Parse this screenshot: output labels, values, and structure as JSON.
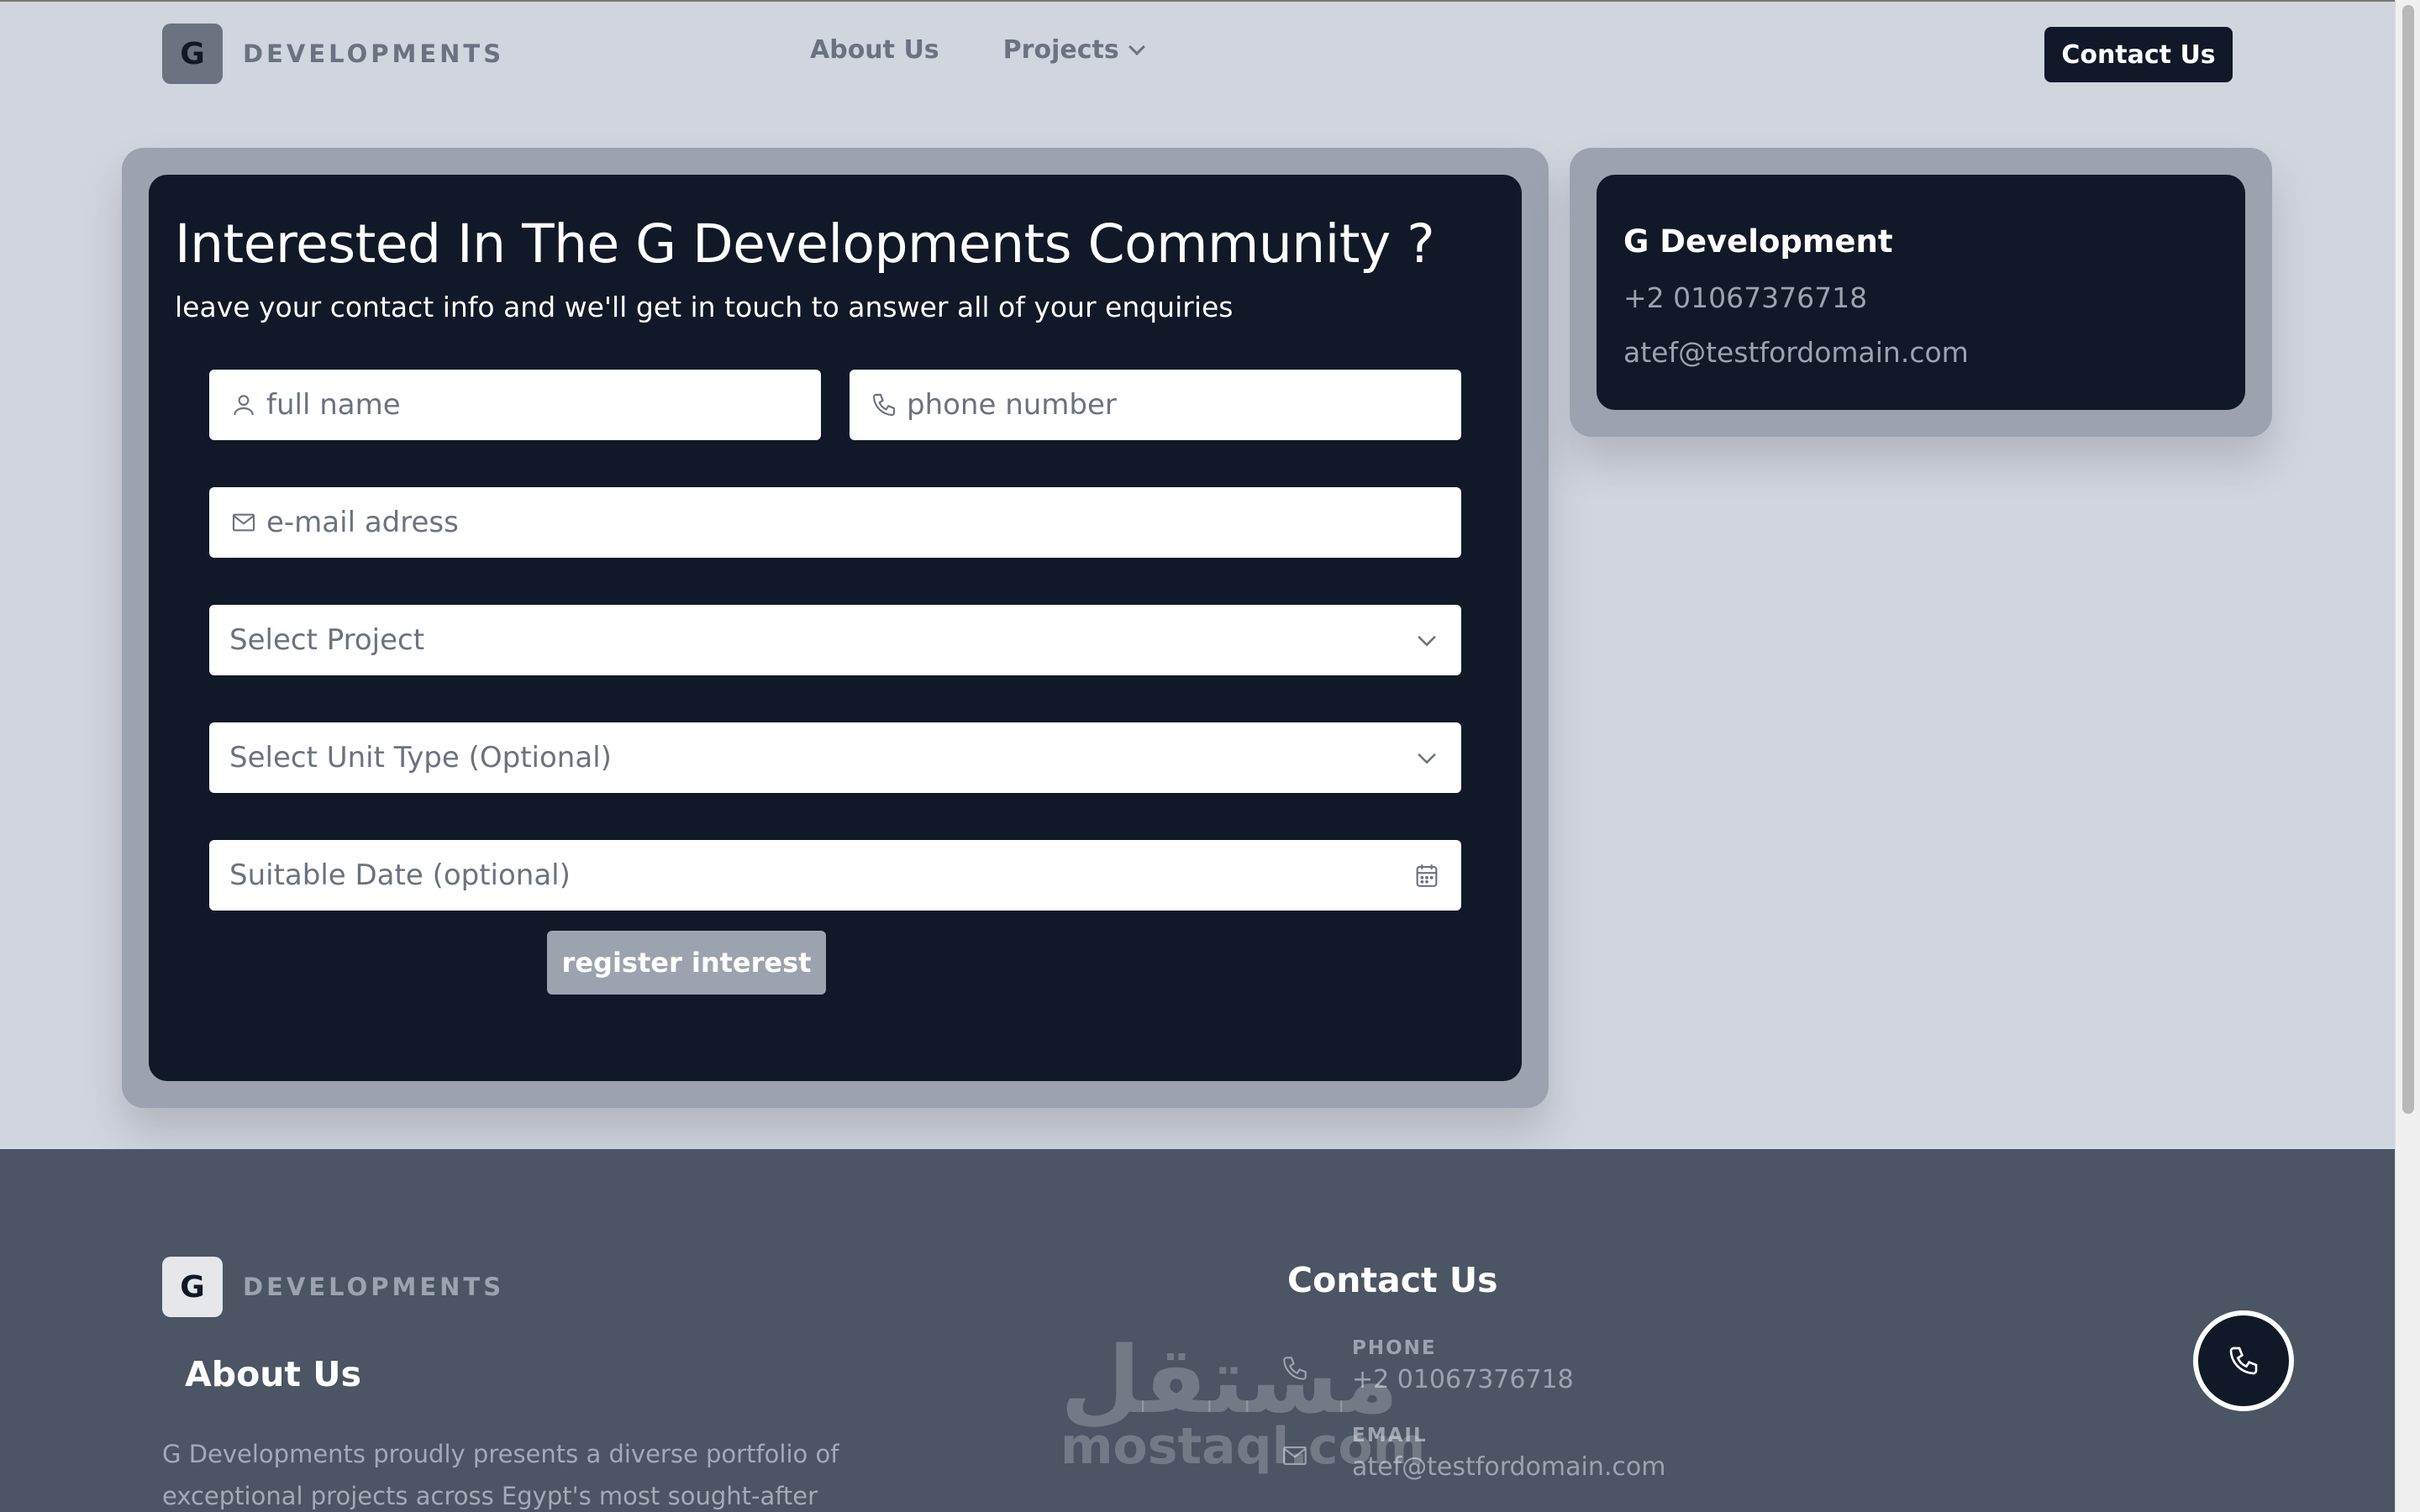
{
  "header": {
    "logo_letter": "G",
    "logo_text": "DEVELOPMENTS",
    "nav": [
      {
        "label": "About Us"
      },
      {
        "label": "Projects"
      }
    ],
    "contact_button": "Contact Us"
  },
  "form": {
    "title": "Interested In The G Developments Community ?",
    "subtitle": "leave your contact info and we'll get in touch to answer all of your enquiries",
    "full_name_placeholder": "full name",
    "phone_placeholder": "phone number",
    "email_placeholder": "e-mail adress",
    "project_select": "Select Project",
    "unit_select": "Select Unit Type (Optional)",
    "date_field": "Suitable Date (optional)",
    "submit": "register interest"
  },
  "info": {
    "name": "G Development",
    "phone": "+2 01067376718",
    "email": "atef@testfordomain.com"
  },
  "footer": {
    "logo_letter": "G",
    "logo_text": "DEVELOPMENTS",
    "about_title": "About Us",
    "about_text": "G Developments proudly presents a diverse portfolio of exceptional projects across Egypt's most sought-after",
    "contact_title": "Contact Us",
    "phone_label": "PHONE",
    "phone_value": "+2 01067376718",
    "email_label": "EMAIL",
    "email_value": "atef@testfordomain.com",
    "watermark_arabic": "مستقل",
    "watermark_latin": "mostaql.com"
  },
  "colors": {
    "dark": "#111827",
    "card_frame": "#9ca3af",
    "page_bg": "#d1d5de",
    "footer_bg": "#4b5563"
  },
  "icons": [
    "user-icon",
    "phone-icon",
    "mail-icon",
    "chevron-down-icon",
    "calendar-icon",
    "call-icon"
  ]
}
